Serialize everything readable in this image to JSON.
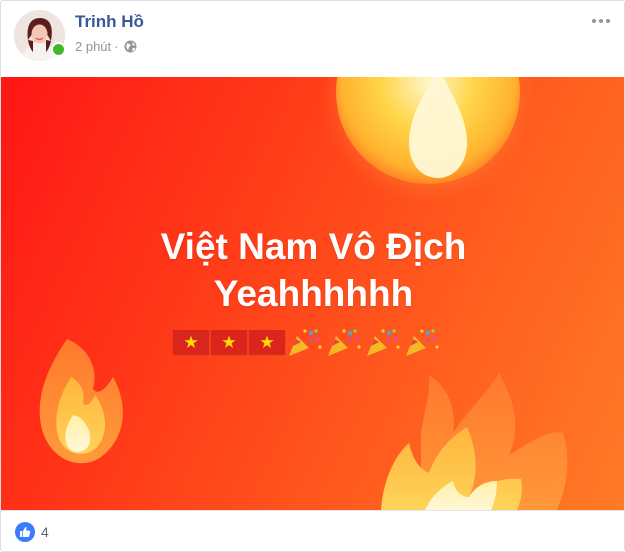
{
  "post": {
    "author": "Trinh Hồ",
    "time": "2 phút",
    "separator": "·",
    "privacy_icon": "globe-icon",
    "more_icon": "more-options-icon",
    "online_color": "#42b72a"
  },
  "banner": {
    "line1": "Việt Nam Vô Địch",
    "line2": "Yeahhhhhh",
    "emojis": [
      "vietnam-flag",
      "vietnam-flag",
      "vietnam-flag",
      "party-popper",
      "party-popper",
      "party-popper",
      "party-popper"
    ],
    "background_colors": [
      "#ff1616",
      "#ff7a27"
    ]
  },
  "reactions": {
    "icon": "like-icon",
    "count": "4",
    "like_color": "#3b7cff"
  }
}
